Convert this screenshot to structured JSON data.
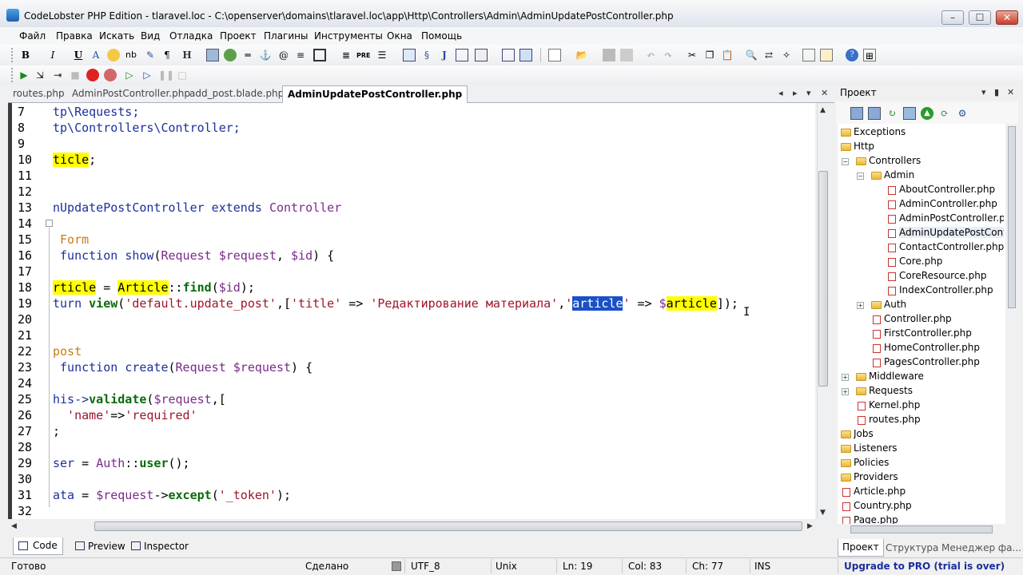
{
  "window": {
    "title": "CodeLobster PHP Edition - tlaravel.loc - C:\\openserver\\domains\\tlaravel.loc\\app\\Http\\Controllers\\Admin\\AdminUpdatePostController.php",
    "min": "–",
    "max": "☐",
    "close": "✕"
  },
  "menu": [
    "Файл",
    "Правка",
    "Искать",
    "Вид",
    "Отладка",
    "Проект",
    "Плагины",
    "Инструменты",
    "Окна",
    "Помощь"
  ],
  "toolbar": {
    "bold": "B",
    "italic": "I",
    "underline": "U",
    "font": "A",
    "nb": "nb",
    "para": "¶",
    "heading": "H",
    "pre": "PRE"
  },
  "tabs": [
    "routes.php",
    "AdminPostController.php",
    "add_post.blade.php",
    "AdminUpdatePostController.php"
  ],
  "tabs_controls": {
    "prev": "◂",
    "next": "▸",
    "menu": "▾",
    "close": "✕"
  },
  "editor": {
    "lines": [
      {
        "n": "7",
        "code": [
          {
            "t": "tp\\Requests;",
            "c": "kw"
          }
        ]
      },
      {
        "n": "8",
        "code": [
          {
            "t": "tp\\Controllers\\Controller;",
            "c": "kw"
          }
        ]
      },
      {
        "n": "9",
        "code": []
      },
      {
        "n": "10",
        "code": [
          {
            "t": "ticle",
            "c": "hl"
          },
          {
            "t": ";",
            "c": "op"
          }
        ]
      },
      {
        "n": "11",
        "code": []
      },
      {
        "n": "12",
        "code": []
      },
      {
        "n": "13",
        "code": [
          {
            "t": "nUpdatePostController",
            "c": "kw"
          },
          {
            "t": " extends ",
            "c": "kw"
          },
          {
            "t": "Controller",
            "c": "cls"
          }
        ]
      },
      {
        "n": "14",
        "code": []
      },
      {
        "n": "15",
        "code": [
          {
            "t": " Form",
            "c": "kwy"
          }
        ]
      },
      {
        "n": "16",
        "code": [
          {
            "t": " function ",
            "c": "kw"
          },
          {
            "t": "show",
            "c": "kw"
          },
          {
            "t": "(",
            "c": "op"
          },
          {
            "t": "Request",
            "c": "cls"
          },
          {
            "t": " $request",
            "c": "var"
          },
          {
            "t": ", ",
            "c": "op"
          },
          {
            "t": "$id",
            "c": "var"
          },
          {
            "t": ") {",
            "c": "op"
          }
        ]
      },
      {
        "n": "17",
        "code": []
      },
      {
        "n": "18",
        "code": [
          {
            "t": "rticle",
            "c": "hl"
          },
          {
            "t": " = ",
            "c": "op"
          },
          {
            "t": "Article",
            "c": "hl"
          },
          {
            "t": "::",
            "c": "op"
          },
          {
            "t": "find",
            "c": "fn"
          },
          {
            "t": "(",
            "c": "op"
          },
          {
            "t": "$id",
            "c": "var"
          },
          {
            "t": ");",
            "c": "op"
          }
        ]
      },
      {
        "n": "19",
        "code": [
          {
            "t": "turn ",
            "c": "kw"
          },
          {
            "t": "view",
            "c": "fn"
          },
          {
            "t": "(",
            "c": "op"
          },
          {
            "t": "'default.update_post'",
            "c": "str"
          },
          {
            "t": ",[",
            "c": "op"
          },
          {
            "t": "'title'",
            "c": "str"
          },
          {
            "t": " => ",
            "c": "op"
          },
          {
            "t": "'Редактирование материала'",
            "c": "str"
          },
          {
            "t": ",",
            "c": "op"
          },
          {
            "t": "'",
            "c": "str"
          },
          {
            "t": "article",
            "c": "sel"
          },
          {
            "t": "'",
            "c": "str"
          },
          {
            "t": " => ",
            "c": "op"
          },
          {
            "t": "$",
            "c": "var"
          },
          {
            "t": "article",
            "c": "hl"
          },
          {
            "t": "]);",
            "c": "op"
          }
        ]
      },
      {
        "n": "20",
        "code": []
      },
      {
        "n": "21",
        "code": []
      },
      {
        "n": "22",
        "code": [
          {
            "t": "post",
            "c": "kwy"
          }
        ]
      },
      {
        "n": "23",
        "code": [
          {
            "t": " function ",
            "c": "kw"
          },
          {
            "t": "create",
            "c": "kw"
          },
          {
            "t": "(",
            "c": "op"
          },
          {
            "t": "Request",
            "c": "cls"
          },
          {
            "t": " $request",
            "c": "var"
          },
          {
            "t": ") {",
            "c": "op"
          }
        ]
      },
      {
        "n": "24",
        "code": []
      },
      {
        "n": "25",
        "code": [
          {
            "t": "his->",
            "c": "kw"
          },
          {
            "t": "validate",
            "c": "fn"
          },
          {
            "t": "(",
            "c": "op"
          },
          {
            "t": "$request",
            "c": "var"
          },
          {
            "t": ",[",
            "c": "op"
          }
        ]
      },
      {
        "n": "26",
        "code": [
          {
            "t": "  'name'",
            "c": "str"
          },
          {
            "t": "=>",
            "c": "op"
          },
          {
            "t": "'required'",
            "c": "str"
          }
        ]
      },
      {
        "n": "27",
        "code": [
          {
            "t": ";",
            "c": "op"
          }
        ]
      },
      {
        "n": "28",
        "code": []
      },
      {
        "n": "29",
        "code": [
          {
            "t": "ser",
            "c": "kw"
          },
          {
            "t": " = ",
            "c": "op"
          },
          {
            "t": "Auth",
            "c": "cls"
          },
          {
            "t": "::",
            "c": "op"
          },
          {
            "t": "user",
            "c": "fn"
          },
          {
            "t": "();",
            "c": "op"
          }
        ]
      },
      {
        "n": "30",
        "code": []
      },
      {
        "n": "31",
        "code": [
          {
            "t": "ata",
            "c": "kw"
          },
          {
            "t": " = ",
            "c": "op"
          },
          {
            "t": "$request",
            "c": "var"
          },
          {
            "t": "->",
            "c": "op"
          },
          {
            "t": "except",
            "c": "fn"
          },
          {
            "t": "(",
            "c": "op"
          },
          {
            "t": "'_token'",
            "c": "str"
          },
          {
            "t": ");",
            "c": "op"
          }
        ]
      },
      {
        "n": "32",
        "code": []
      }
    ]
  },
  "view_tabs": [
    "Code",
    "Preview",
    "Inspector"
  ],
  "status": {
    "ready": "Готово",
    "done": "Сделано",
    "encoding": "UTF_8",
    "eol": "Unix",
    "line": "Ln: 19",
    "col": "Col: 83",
    "ch": "Ch: 77",
    "ins": "INS",
    "upgrade": "Upgrade to PRO (trial is over)"
  },
  "project": {
    "title": "Проект",
    "pin": "▾",
    "close": "✕",
    "tree": [
      {
        "label": "Exceptions",
        "type": "folder",
        "depth": 0,
        "exp": ""
      },
      {
        "label": "Http",
        "type": "folder",
        "depth": 0,
        "exp": ""
      },
      {
        "label": "Controllers",
        "type": "folder",
        "depth": 1,
        "exp": "−"
      },
      {
        "label": "Admin",
        "type": "folder",
        "depth": 2,
        "exp": "−"
      },
      {
        "label": "AboutController.php",
        "type": "php",
        "depth": 3,
        "exp": ""
      },
      {
        "label": "AdminController.php",
        "type": "php",
        "depth": 3,
        "exp": ""
      },
      {
        "label": "AdminPostController.php",
        "type": "php",
        "depth": 3,
        "exp": ""
      },
      {
        "label": "AdminUpdatePostController.php",
        "type": "php",
        "depth": 3,
        "exp": ""
      },
      {
        "label": "ContactController.php",
        "type": "php",
        "depth": 3,
        "exp": ""
      },
      {
        "label": "Core.php",
        "type": "php",
        "depth": 3,
        "exp": ""
      },
      {
        "label": "CoreResource.php",
        "type": "php",
        "depth": 3,
        "exp": ""
      },
      {
        "label": "IndexController.php",
        "type": "php",
        "depth": 3,
        "exp": ""
      },
      {
        "label": "Auth",
        "type": "folder",
        "depth": 2,
        "exp": "+"
      },
      {
        "label": "Controller.php",
        "type": "php",
        "depth": 2,
        "exp": ""
      },
      {
        "label": "FirstController.php",
        "type": "php",
        "depth": 2,
        "exp": ""
      },
      {
        "label": "HomeController.php",
        "type": "php",
        "depth": 2,
        "exp": ""
      },
      {
        "label": "PagesController.php",
        "type": "php",
        "depth": 2,
        "exp": ""
      },
      {
        "label": "Middleware",
        "type": "folder",
        "depth": 1,
        "exp": "+"
      },
      {
        "label": "Requests",
        "type": "folder",
        "depth": 1,
        "exp": "+"
      },
      {
        "label": "Kernel.php",
        "type": "php",
        "depth": 1,
        "exp": ""
      },
      {
        "label": "routes.php",
        "type": "php",
        "depth": 1,
        "exp": ""
      },
      {
        "label": "Jobs",
        "type": "folder",
        "depth": 0,
        "exp": ""
      },
      {
        "label": "Listeners",
        "type": "folder",
        "depth": 0,
        "exp": ""
      },
      {
        "label": "Policies",
        "type": "folder",
        "depth": 0,
        "exp": ""
      },
      {
        "label": "Providers",
        "type": "folder",
        "depth": 0,
        "exp": ""
      },
      {
        "label": "Article.php",
        "type": "php",
        "depth": 0,
        "exp": ""
      },
      {
        "label": "Country.php",
        "type": "php",
        "depth": 0,
        "exp": ""
      },
      {
        "label": "Page.php",
        "type": "php",
        "depth": 0,
        "exp": ""
      }
    ],
    "tabs": [
      "Проект",
      "Структура",
      "Менеджер фа..."
    ],
    "tab_scroll_left": "◂",
    "tab_scroll_right": "▸"
  }
}
